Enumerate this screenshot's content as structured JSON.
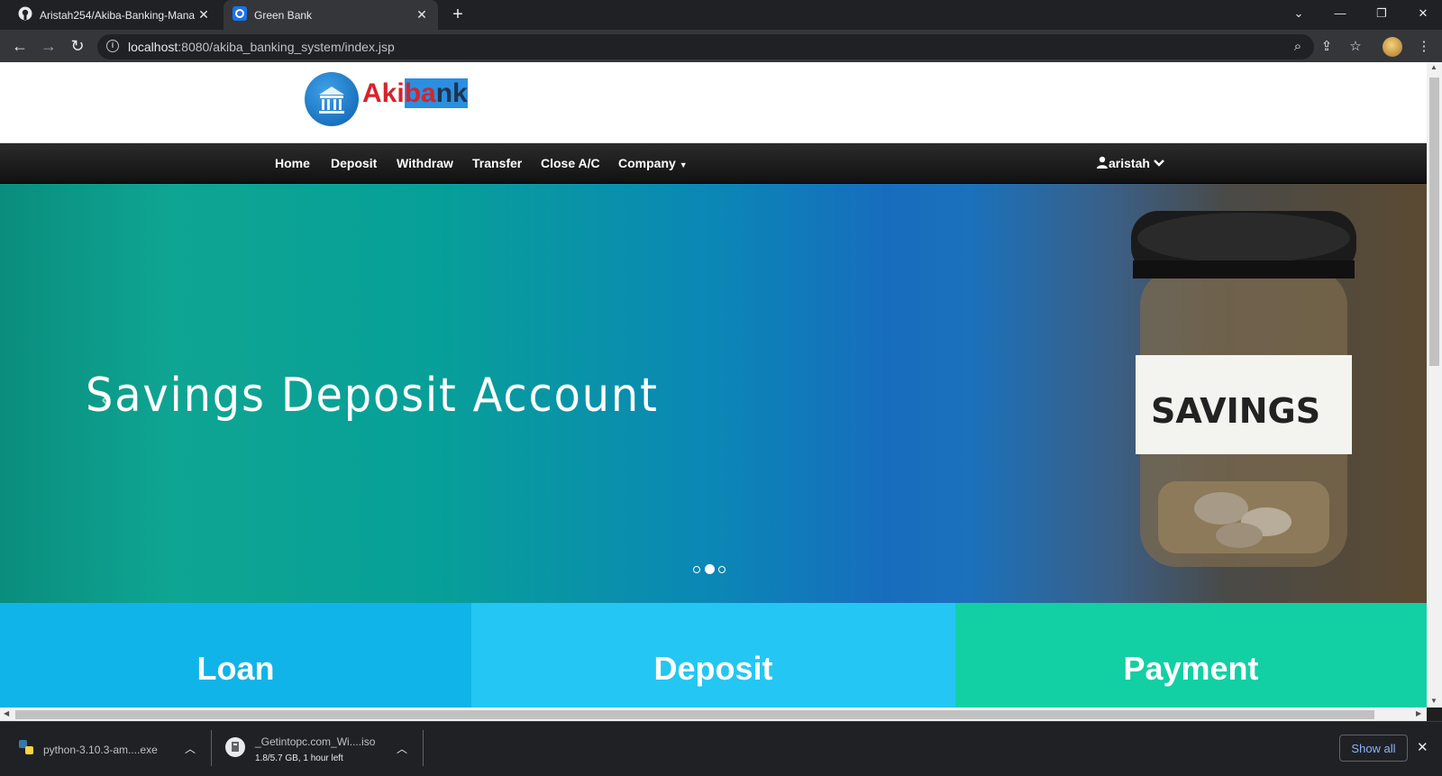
{
  "browser": {
    "tabs": [
      {
        "title": "Aristah254/Akiba-Banking-Mana",
        "icon": "github-icon",
        "active": false
      },
      {
        "title": "Green Bank",
        "icon": "site-favicon",
        "active": true
      }
    ],
    "url_host": "localhost",
    "url_path": ":8080/akiba_banking_system/index.jsp"
  },
  "site": {
    "logo_part1": "Aki",
    "logo_part2": "ba",
    "logo_part3": "nk",
    "nav": {
      "home": "Home",
      "deposit": "Deposit",
      "withdraw": "Withdraw",
      "transfer": "Transfer",
      "close_ac": "Close A/C",
      "company": "Company"
    },
    "user": "aristah",
    "hero": {
      "caption": "Savings  Deposit  Account",
      "jar_label": "SAVINGS",
      "slide_count": 3,
      "active_slide": 2
    },
    "cards": [
      {
        "title": "Loan",
        "color": "#10b4e8"
      },
      {
        "title": "Deposit",
        "color": "#24c6f3"
      },
      {
        "title": "Payment",
        "color": "#12d0a4"
      }
    ]
  },
  "downloads": {
    "items": [
      {
        "name": "python-3.10.3-am....exe",
        "status": ""
      },
      {
        "name": "_Getintopc.com_Wi....iso",
        "status": "1.8/5.7 GB, 1 hour left"
      }
    ],
    "show_all": "Show all"
  }
}
